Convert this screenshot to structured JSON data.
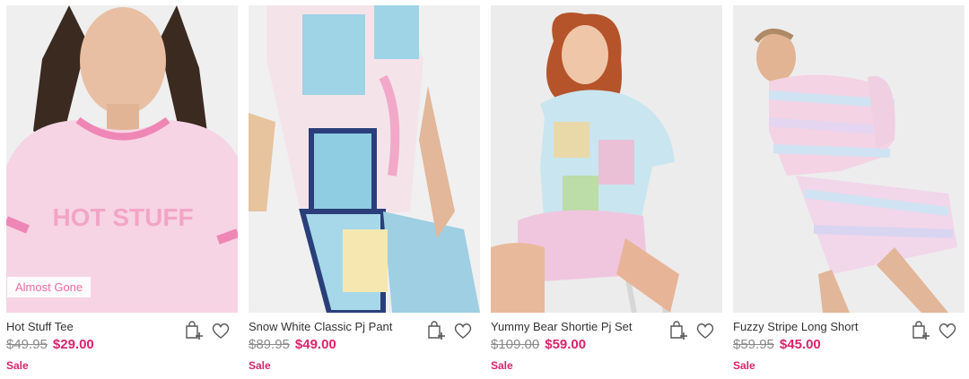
{
  "products": [
    {
      "name": "Hot Stuff Tee",
      "original_price": "$49.95",
      "sale_price": "$29.00",
      "sale_label": "Sale",
      "badge": "Almost Gone",
      "image_text": "HOT STUFF"
    },
    {
      "name": "Snow White Classic Pj Pant",
      "original_price": "$89.95",
      "sale_price": "$49.00",
      "sale_label": "Sale"
    },
    {
      "name": "Yummy Bear Shortie Pj Set",
      "original_price": "$109.00",
      "sale_price": "$59.00",
      "sale_label": "Sale"
    },
    {
      "name": "Fuzzy Stripe Long Short",
      "original_price": "$59.95",
      "sale_price": "$45.00",
      "sale_label": "Sale"
    }
  ],
  "icons": {
    "bag": "add-to-bag-icon",
    "wishlist": "heart-icon"
  },
  "colors": {
    "sale": "#d9246d",
    "badge_text": "#e8649b",
    "strike": "#8a8a8a"
  }
}
